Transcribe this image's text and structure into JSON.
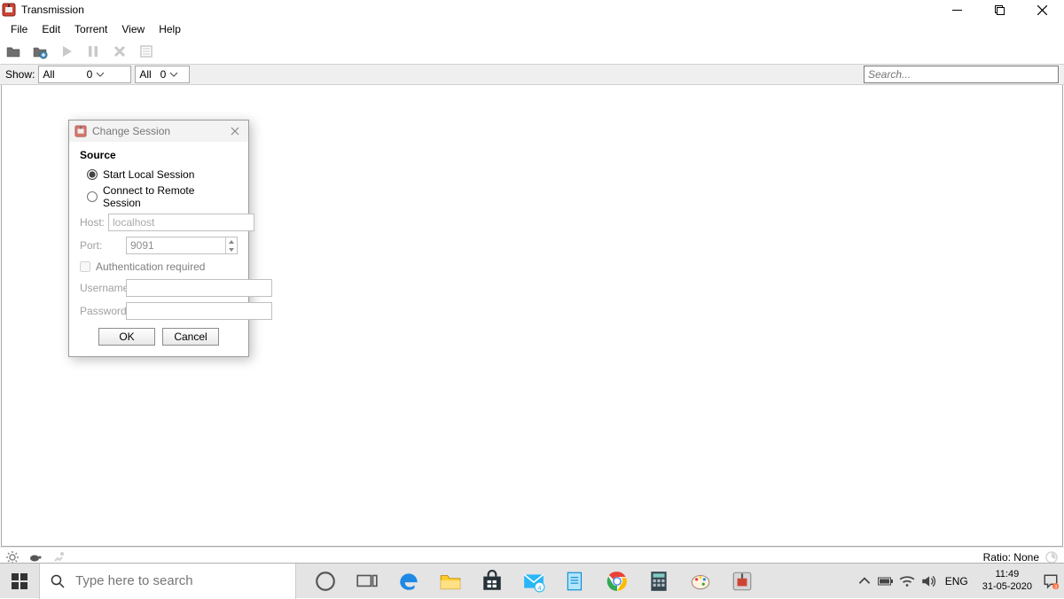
{
  "title": "Transmission",
  "menu": {
    "file": "File",
    "edit": "Edit",
    "torrent": "Torrent",
    "view": "View",
    "help": "Help"
  },
  "filter": {
    "show_label": "Show:",
    "all_1": "All",
    "count_1": "0",
    "all_2": "All",
    "count_2": "0"
  },
  "search": {
    "placeholder": "Search..."
  },
  "dialog": {
    "title": "Change Session",
    "source_label": "Source",
    "radio_local": "Start Local Session",
    "radio_remote": "Connect to Remote Session",
    "host_label": "Host:",
    "host_value": "localhost",
    "port_label": "Port:",
    "port_value": "9091",
    "auth_label": "Authentication required",
    "username_label": "Username:",
    "password_label": "Password:",
    "ok": "OK",
    "cancel": "Cancel"
  },
  "status": {
    "ratio": "Ratio: None"
  },
  "taskbar": {
    "search_placeholder": "Type here to search",
    "lang": "ENG",
    "time": "11:49",
    "date": "31-05-2020"
  }
}
